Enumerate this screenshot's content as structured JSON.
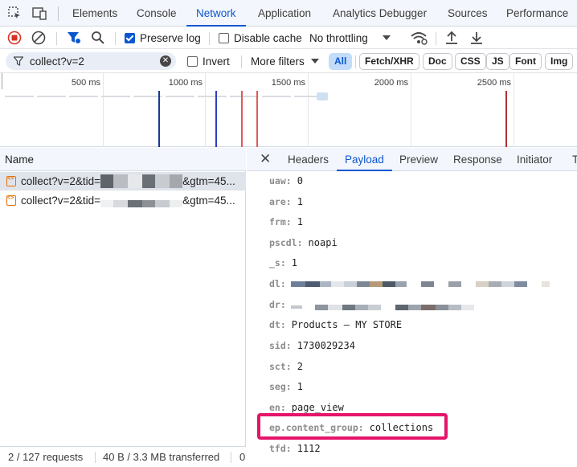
{
  "devtools": {
    "tabs": [
      {
        "label": "Elements"
      },
      {
        "label": "Console"
      },
      {
        "label": "Network"
      },
      {
        "label": "Application"
      },
      {
        "label": "Analytics Debugger"
      },
      {
        "label": "Sources"
      },
      {
        "label": "Performance"
      }
    ],
    "active_tab": "Network"
  },
  "toolbar": {
    "preserve_log_label": "Preserve log",
    "preserve_log_checked": true,
    "disable_cache_label": "Disable cache",
    "disable_cache_checked": false,
    "throttling_value": "No throttling"
  },
  "filter_bar": {
    "filter_text": "collect?v=2",
    "invert_label": "Invert",
    "more_filters_label": "More filters",
    "type_pills": [
      "All",
      "Fetch/XHR",
      "Doc",
      "CSS",
      "JS",
      "Font",
      "Img"
    ],
    "active_pill": "All"
  },
  "timeline": {
    "tick_labels": [
      "500 ms",
      "1000 ms",
      "1500 ms",
      "2000 ms",
      "2500 ms"
    ],
    "colors": {
      "blue": "#1a3a8f",
      "navy": "#2b3fbf",
      "red": "#e05a5a",
      "darkred": "#b33030"
    }
  },
  "request_list": {
    "header": "Name",
    "rows": [
      {
        "prefix": "collect?v=2&tid=",
        "suffix": "&gtm=45..."
      },
      {
        "prefix": "collect?v=2&tid=",
        "suffix": "&gtm=45..."
      }
    ]
  },
  "status_bar": {
    "requests": "2 / 127 requests",
    "transferred": "40 B / 3.3 MB transferred",
    "overflow": "0"
  },
  "detail": {
    "tabs": [
      "Headers",
      "Payload",
      "Preview",
      "Response",
      "Initiator",
      "T"
    ],
    "active_tab": "Payload",
    "params": [
      {
        "key": "uaw:",
        "value": "0"
      },
      {
        "key": "are:",
        "value": "1"
      },
      {
        "key": "frm:",
        "value": "1"
      },
      {
        "key": "pscdl:",
        "value": "noapi"
      },
      {
        "key": "_s:",
        "value": "1"
      },
      {
        "key": "dl:",
        "value": ""
      },
      {
        "key": "dr:",
        "value": ""
      },
      {
        "key": "dt:",
        "value": "Products – MY STORE"
      },
      {
        "key": "sid:",
        "value": "1730029234"
      },
      {
        "key": "sct:",
        "value": "2"
      },
      {
        "key": "seg:",
        "value": "1"
      },
      {
        "key": "en:",
        "value": "page_view"
      },
      {
        "key": "ep.content_group:",
        "value": "collections"
      },
      {
        "key": "tfd:",
        "value": "1112"
      }
    ],
    "highlighted_param": "ep.content_group:",
    "highlight_color": "#e5146a"
  }
}
